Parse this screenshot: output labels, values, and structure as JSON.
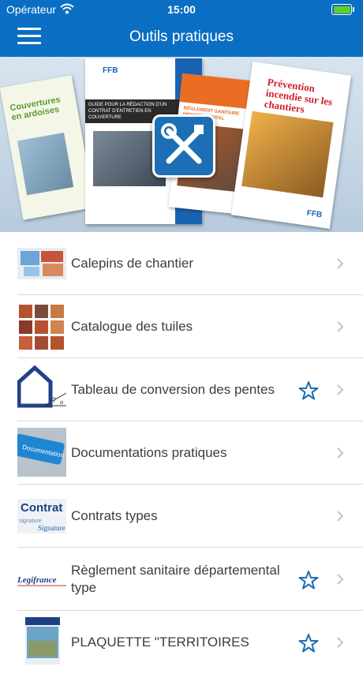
{
  "status_bar": {
    "carrier": "Opérateur",
    "time": "15:00"
  },
  "nav": {
    "title": "Outils pratiques"
  },
  "banner": {
    "cover1_title": "Couvertures en ardoises",
    "cover2_brand": "FFB",
    "cover2_title": "GUIDE POUR LA RÉDACTION D'UN CONTRAT D'ENTRETIEN EN COUVERTURE",
    "cover3_title": "RÉGLEMENT SANITAIRE DÉPARTEMENTAL",
    "cover4_title": "Prévention incendie sur les chantiers",
    "cover4_brand": "FFB"
  },
  "items": [
    {
      "label": "Calepins de chantier",
      "icon": "calepins-thumbnail",
      "starred": false
    },
    {
      "label": "Catalogue des tuiles",
      "icon": "tiles-thumbnail",
      "starred": false
    },
    {
      "label": "Tableau de conversion des pentes",
      "icon": "house-slope-thumbnail",
      "starred": true
    },
    {
      "label": "Documentations pratiques",
      "icon": "documentation-key-thumbnail",
      "starred": false
    },
    {
      "label": "Contrats types",
      "icon": "contrat-thumbnail",
      "starred": false
    },
    {
      "label": "Règlement sanitaire départemental type",
      "icon": "legifrance-thumbnail",
      "starred": true,
      "thumb_text": "Legifrance"
    },
    {
      "label": "PLAQUETTE \"TERRITOIRES",
      "icon": "plaquette-thumbnail",
      "starred": true
    }
  ],
  "colors": {
    "nav_bg": "#0a6fc2",
    "accent": "#1c6fb5",
    "text": "#3d3d3d"
  }
}
